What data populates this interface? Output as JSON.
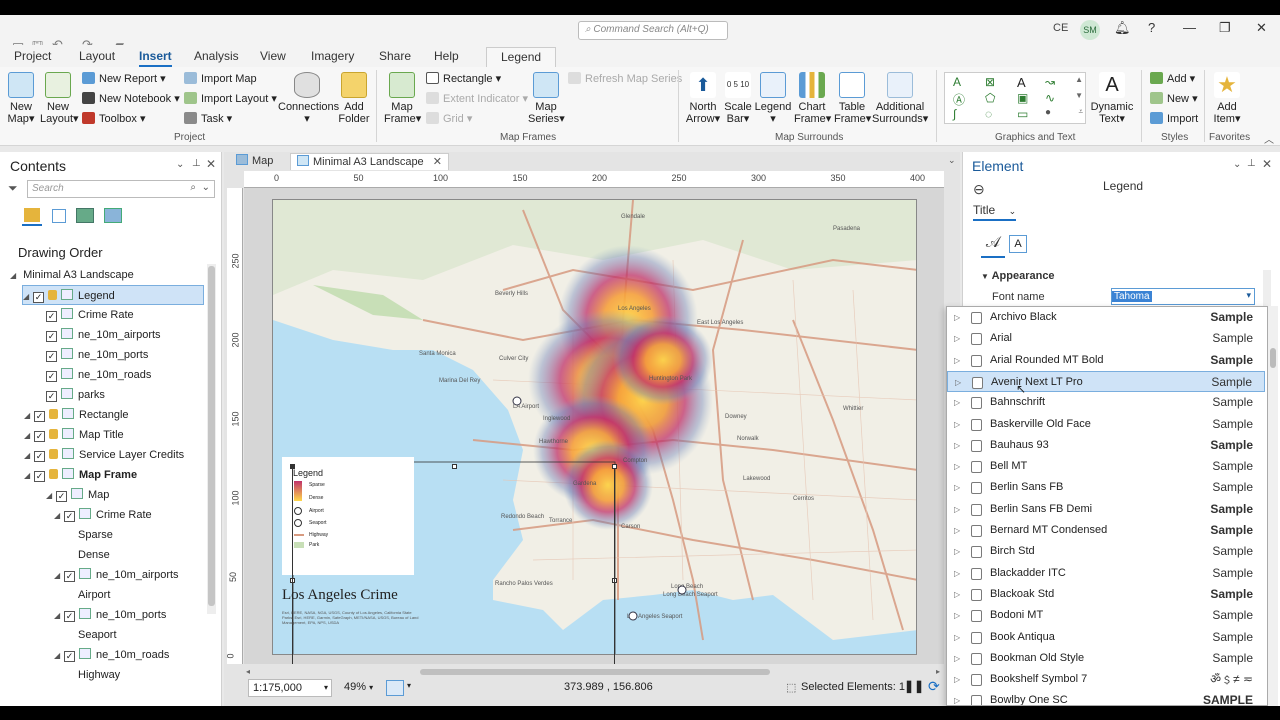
{
  "titlebar": {
    "command_search_placeholder": "Command Search (Alt+Q)",
    "user_initials": "CE",
    "avatar_initials": "SM"
  },
  "ribbon_tabs": [
    "Project",
    "Layout",
    "Insert",
    "Analysis",
    "View",
    "Imagery",
    "Share",
    "Help",
    "Legend"
  ],
  "ribbon": {
    "project": {
      "new_map": "New\nMap",
      "new_layout": "New\nLayout",
      "new_report": "New Report",
      "new_notebook": "New Notebook",
      "toolbox": "Toolbox",
      "import_map": "Import Map",
      "import_layout": "Import Layout",
      "task": "Task",
      "connections": "Connections",
      "add_folder": "Add\nFolder",
      "group_label": "Project"
    },
    "map_frames": {
      "map_frame": "Map\nFrame",
      "rectangle": "Rectangle",
      "extent_indicator": "Extent Indicator",
      "grid": "Grid",
      "map_series": "Map\nSeries",
      "refresh_map_series": "Refresh Map Series",
      "group_label": "Map Frames"
    },
    "map_surrounds": {
      "north_arrow": "North\nArrow",
      "scale_bar": "Scale\nBar",
      "legend": "Legend",
      "chart_frame": "Chart\nFrame",
      "table_frame": "Table\nFrame",
      "additional_surrounds": "Additional\nSurrounds",
      "group_label": "Map Surrounds"
    },
    "graphics_text": {
      "dynamic_text": "Dynamic\nText",
      "group_label": "Graphics and Text"
    },
    "styles": {
      "add": "Add",
      "new": "New",
      "import": "Import",
      "group_label": "Styles"
    },
    "favorites": {
      "add_item": "Add\nItem",
      "group_label": "Favorites"
    }
  },
  "contents": {
    "title": "Contents",
    "search_placeholder": "Search",
    "drawing_order": "Drawing Order",
    "layout_name": "Minimal A3 Landscape",
    "items": [
      {
        "label": "Legend",
        "indent": 1
      },
      {
        "label": "Crime Rate",
        "indent": 2
      },
      {
        "label": "ne_10m_airports",
        "indent": 2
      },
      {
        "label": "ne_10m_ports",
        "indent": 2
      },
      {
        "label": "ne_10m_roads",
        "indent": 2
      },
      {
        "label": "parks",
        "indent": 2
      },
      {
        "label": "Rectangle",
        "indent": 1
      },
      {
        "label": "Map Title",
        "indent": 1
      },
      {
        "label": "Service Layer Credits",
        "indent": 1
      },
      {
        "label": "Map Frame",
        "indent": 1
      },
      {
        "label": "Map",
        "indent": 2
      },
      {
        "label": "Crime Rate",
        "indent": 3
      },
      {
        "label": "Sparse",
        "indent": 4
      },
      {
        "label": "Dense",
        "indent": 4
      },
      {
        "label": "ne_10m_airports",
        "indent": 3
      },
      {
        "label": "Airport",
        "indent": 4
      },
      {
        "label": "ne_10m_ports",
        "indent": 3
      },
      {
        "label": "Seaport",
        "indent": 4
      },
      {
        "label": "ne_10m_roads",
        "indent": 3
      },
      {
        "label": "Highway",
        "indent": 4
      }
    ]
  },
  "doc_tabs": [
    "Map",
    "Minimal A3 Landscape"
  ],
  "ruler": {
    "h_ticks": [
      "0",
      "50",
      "100",
      "150",
      "200",
      "250",
      "300",
      "350",
      "400"
    ],
    "v_ticks": [
      "250",
      "200",
      "150",
      "100",
      "50",
      "0"
    ]
  },
  "layout_page": {
    "legend_title": "Legend",
    "legend_items": [
      "Sparse",
      "Dense",
      "Airport",
      "Seaport",
      "Highway",
      "Park"
    ],
    "map_title": "Los Angeles Crime",
    "credits": "Esri, HERE, NASA, NGA, USGS, County of Los Angeles, California State Parks, Esri, HERE, Garmin, SafeGraph, METI/NASA, USGS, Bureau of Land Management, EPA, NPS, USDA",
    "place_labels": [
      "Glendale",
      "Beverly Hills",
      "Los Angeles",
      "East Los Angeles",
      "Culver City",
      "Huntington Park",
      "Inglewood",
      "Downey",
      "Hawthorne",
      "Norwalk",
      "Compton",
      "Redondo Beach",
      "Torrance",
      "Carson",
      "Cerritos",
      "Long Beach",
      "Rancho Palos Verdes",
      "Santa Monica",
      "Marina Del Rey",
      "LA Airport",
      "Long Beach Seaport",
      "Los Angeles Seaport",
      "Lakewood",
      "Gardena",
      "Pasadena",
      "Whittier"
    ]
  },
  "statusbar": {
    "scale": "1:175,000",
    "zoom": "49%",
    "coords": "373.989 , 156.806",
    "selected": "Selected Elements: 1"
  },
  "element_pane": {
    "title": "Element",
    "subtitle": "Legend",
    "dropdown": "Title",
    "section": "Appearance",
    "font_label": "Font name",
    "font_value": "Tahoma"
  },
  "font_list": [
    {
      "name": "Archivo Black",
      "sample": "Sample",
      "w": "bold"
    },
    {
      "name": "Arial",
      "sample": "Sample",
      "w": "normal"
    },
    {
      "name": "Arial Rounded MT Bold",
      "sample": "Sample",
      "w": "bold"
    },
    {
      "name": "Avenir Next LT Pro",
      "sample": "Sample",
      "w": "normal"
    },
    {
      "name": "Bahnschrift",
      "sample": "Sample",
      "w": "normal"
    },
    {
      "name": "Baskerville Old Face",
      "sample": "Sample",
      "w": "normal"
    },
    {
      "name": "Bauhaus 93",
      "sample": "Sample",
      "w": "bold"
    },
    {
      "name": "Bell MT",
      "sample": "Sample",
      "w": "normal"
    },
    {
      "name": "Berlin Sans FB",
      "sample": "Sample",
      "w": "normal"
    },
    {
      "name": "Berlin Sans FB Demi",
      "sample": "Sample",
      "w": "bold"
    },
    {
      "name": "Bernard MT Condensed",
      "sample": "Sample",
      "w": "bold"
    },
    {
      "name": "Birch Std",
      "sample": "Sample",
      "w": "normal"
    },
    {
      "name": "Blackadder ITC",
      "sample": "Sample",
      "w": "normal"
    },
    {
      "name": "Blackoak Std",
      "sample": "Sample",
      "w": "bold"
    },
    {
      "name": "Bodoni MT",
      "sample": "Sample",
      "w": "normal"
    },
    {
      "name": "Book Antiqua",
      "sample": "Sample",
      "w": "normal"
    },
    {
      "name": "Bookman Old Style",
      "sample": "Sample",
      "w": "normal"
    },
    {
      "name": "Bookshelf Symbol 7",
      "sample": "ॐ﹩≠ ≂",
      "w": "normal"
    },
    {
      "name": "Bowlby One SC",
      "sample": "SAMPLE",
      "w": "bold"
    }
  ],
  "selected_font_index": 3,
  "colors": {
    "accent": "#1a6fc4",
    "water": "#b8dff3",
    "land": "#f1efe6",
    "road": "#d79a80",
    "park": "#c8dfb7",
    "heat_low": "#8aa6c8",
    "heat_mid": "#c0326a",
    "heat_high": "#ffd84a"
  }
}
